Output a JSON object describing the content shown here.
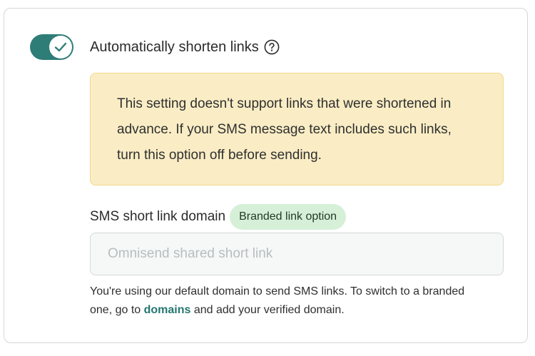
{
  "auto_shorten": {
    "label": "Automatically shorten links",
    "enabled": true,
    "toggle_icon": "check-icon",
    "help_icon": "question-circle-icon"
  },
  "warning": {
    "text": "This setting doesn't support links that were shortened in advance. If your SMS message text includes such links, turn this option off before sending."
  },
  "domain": {
    "label": "SMS short link domain",
    "badge": "Branded link option",
    "placeholder": "Omnisend shared short link",
    "value": "",
    "help_before": "You're using our default domain to send SMS links. To switch to a branded one, go to ",
    "help_link": "domains",
    "help_after": " and add your verified domain."
  },
  "colors": {
    "accent": "#2e7d77",
    "warning_bg": "#faedc5",
    "badge_bg": "#d6f0d8",
    "link": "#23776f"
  }
}
